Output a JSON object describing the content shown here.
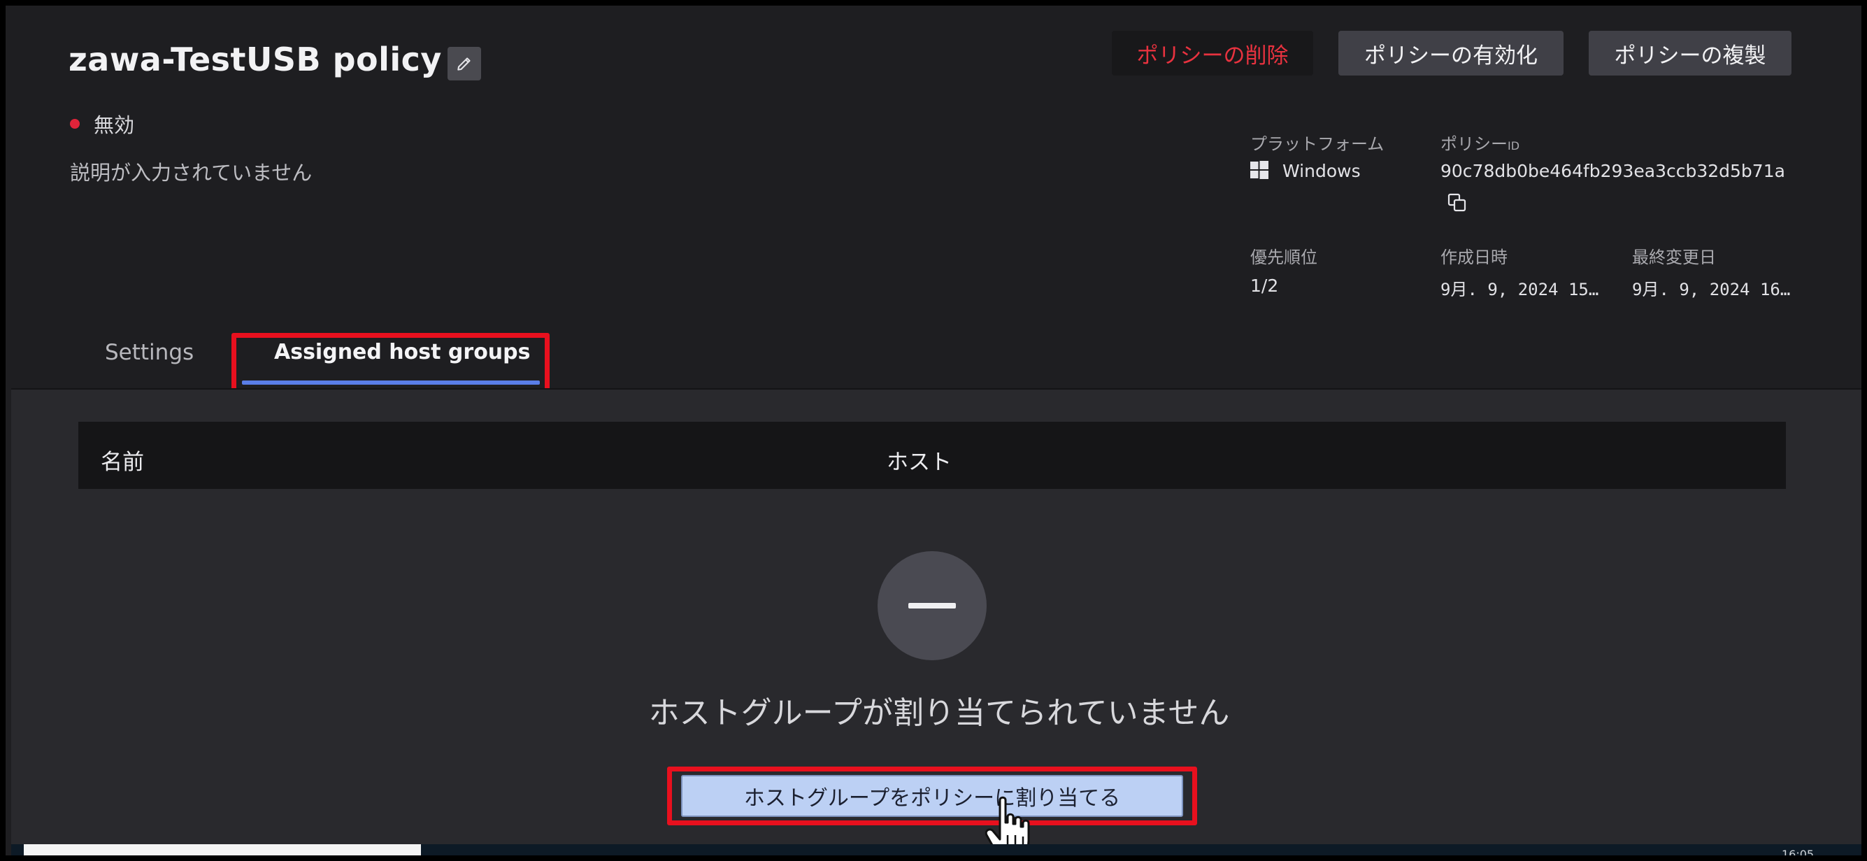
{
  "policy": {
    "title": "zawa-TestUSB policy",
    "status": "無効",
    "status_color": "#e0243a",
    "description": "説明が入力されていません"
  },
  "actions": {
    "delete_label": "ポリシーの削除",
    "enable_label": "ポリシーの有効化",
    "duplicate_label": "ポリシーの複製"
  },
  "meta": {
    "platform_label": "プラットフォーム",
    "platform_value": "Windows",
    "policy_id_label": "ポリシー",
    "policy_id_label_suffix": "ID",
    "policy_id_value": "90c78db0be464fb293ea3ccb32d5b71a",
    "priority_label": "優先順位",
    "priority_value": "1/2",
    "created_label": "作成日時",
    "created_value": "9月. 9, 2024 15…",
    "modified_label": "最終変更日",
    "modified_value": "9月. 9, 2024 16…"
  },
  "tabs": [
    {
      "label": "Settings",
      "active": false
    },
    {
      "label": "Assigned host groups",
      "active": true
    }
  ],
  "table": {
    "columns": [
      "名前",
      "ホスト"
    ]
  },
  "empty_state": {
    "message": "ホストグループが割り当てられていません",
    "button_label": "ホストグループをポリシーに割り当てる"
  },
  "colors": {
    "accent": "#5a7ee8",
    "danger": "#e8323f",
    "annotation": "#e8101e"
  },
  "icons": {
    "edit": "pencil-icon",
    "platform": "windows-icon",
    "copy": "copy-icon",
    "empty": "minus-circle-icon",
    "cursor": "hand-pointer-icon"
  },
  "taskbar": {
    "clock": "16:05"
  }
}
